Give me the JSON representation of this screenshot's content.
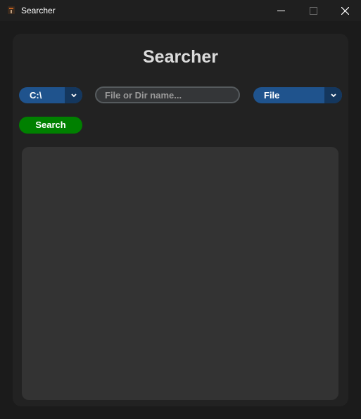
{
  "window": {
    "title": "Searcher",
    "controls": {
      "minimize": "minimize-icon",
      "maximize": "maximize-icon",
      "close": "close-icon"
    }
  },
  "main": {
    "heading": "Searcher",
    "drive_select": {
      "selected": "C:\\"
    },
    "search_field": {
      "placeholder": "File or Dir name...",
      "value": ""
    },
    "type_select": {
      "selected": "File"
    },
    "search_button_label": "Search",
    "results": []
  },
  "colors": {
    "combo_bg": "#1f538d",
    "combo_arrow_bg": "#14375e",
    "search_button_bg": "#008000",
    "panel_bg": "#222222",
    "results_bg": "#333333"
  }
}
